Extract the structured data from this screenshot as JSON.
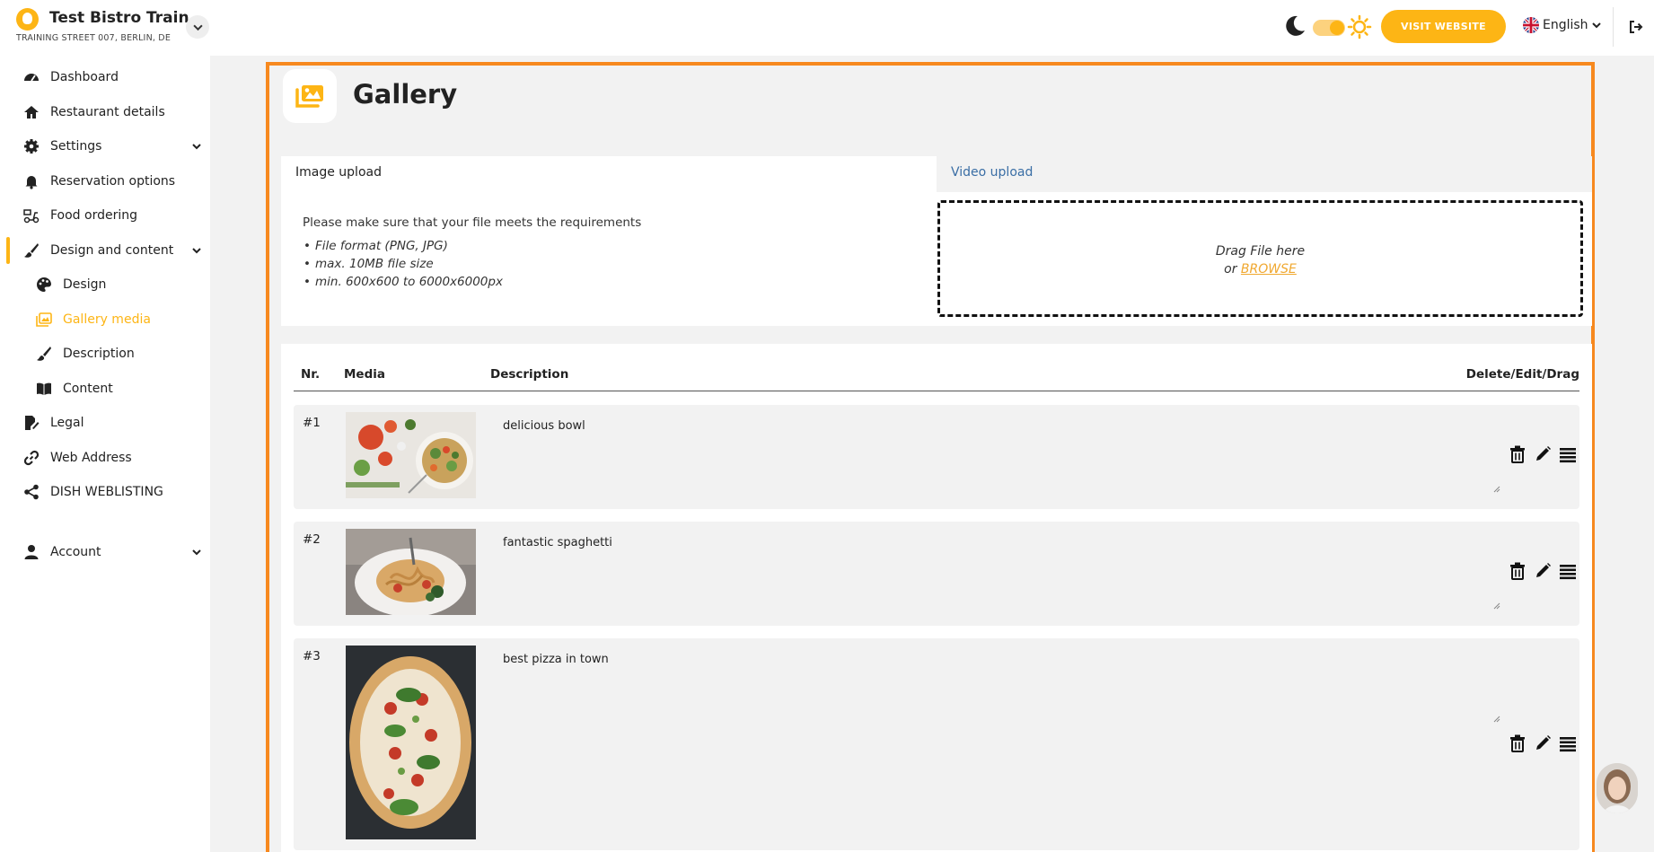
{
  "brand": {
    "name": "Test Bistro Train..",
    "address": "TRAINING STREET 007, BERLIN, DE"
  },
  "header": {
    "visit_label": "VISIT WEBSITE",
    "language": "English"
  },
  "sidebar": {
    "items": [
      {
        "label": "Dashboard"
      },
      {
        "label": "Restaurant details"
      },
      {
        "label": "Settings"
      },
      {
        "label": "Reservation options"
      },
      {
        "label": "Food ordering"
      },
      {
        "label": "Design and content"
      },
      {
        "label": "Design"
      },
      {
        "label": "Gallery media"
      },
      {
        "label": "Description"
      },
      {
        "label": "Content"
      },
      {
        "label": "Legal"
      },
      {
        "label": "Web Address"
      },
      {
        "label": "DISH WEBLISTING"
      },
      {
        "label": "Account"
      }
    ]
  },
  "page": {
    "title": "Gallery",
    "tabs": {
      "image": "Image upload",
      "video": "Video upload"
    },
    "requirements": {
      "intro": "Please make sure that your file meets the requirements",
      "items": [
        "File format (PNG, JPG)",
        "max. 10MB file size",
        "min. 600x600 to 6000x6000px"
      ]
    },
    "dropzone": {
      "line1": "Drag File here",
      "or": "or",
      "browse": "BROWSE"
    },
    "table": {
      "headers": {
        "nr": "Nr.",
        "media": "Media",
        "description": "Description",
        "actions": "Delete/Edit/Drag"
      },
      "rows": [
        {
          "nr": "#1",
          "description": "delicious bowl"
        },
        {
          "nr": "#2",
          "description": "fantastic spaghetti"
        },
        {
          "nr": "#3",
          "description": "best pizza in town"
        }
      ]
    }
  },
  "colors": {
    "accent": "#fdb515",
    "frame": "#f7891f",
    "link": "#3a6ea5"
  }
}
